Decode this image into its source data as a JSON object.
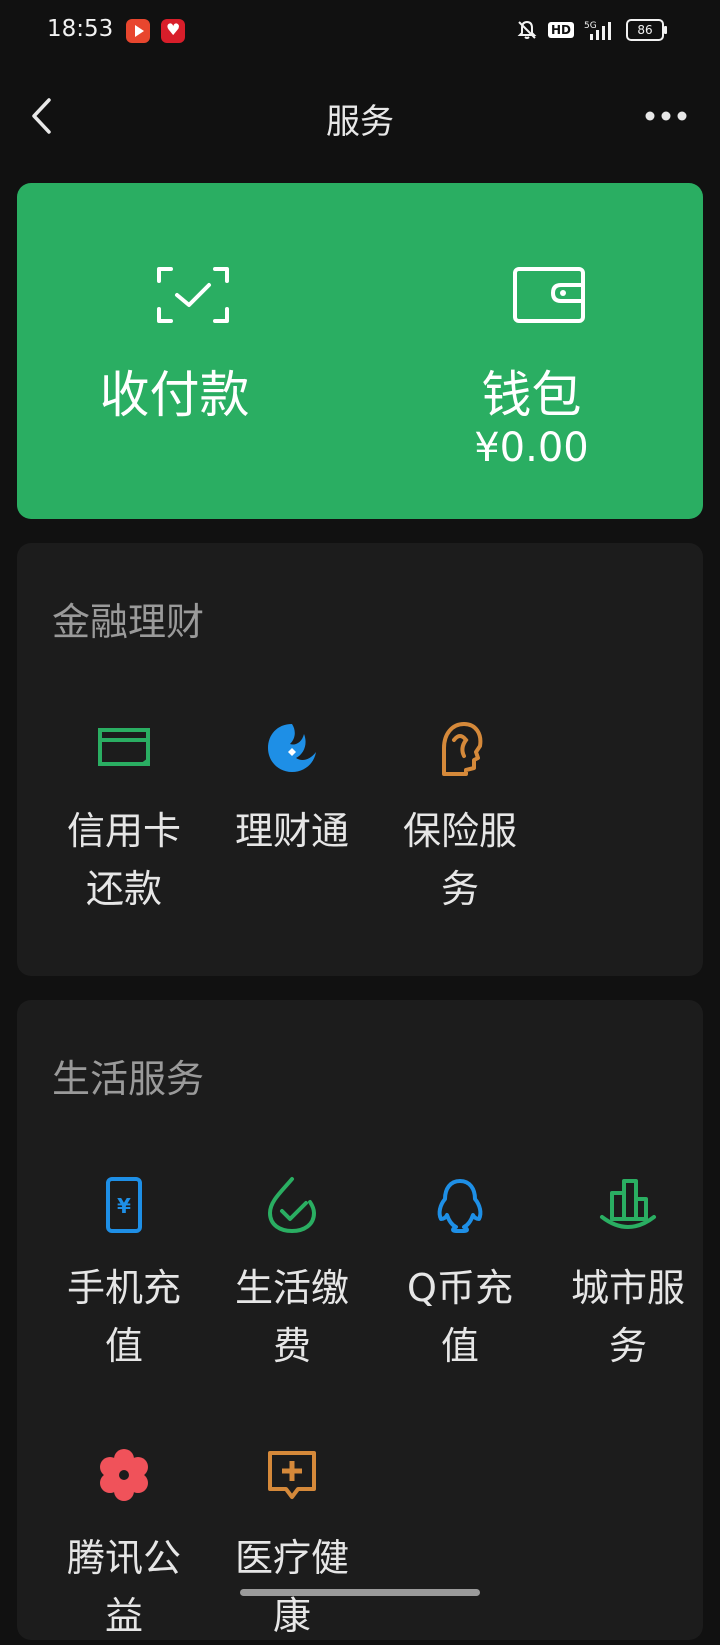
{
  "status_bar": {
    "time": "18:53",
    "hd": "HD",
    "network": "5G",
    "battery": "86"
  },
  "nav": {
    "title": "服务"
  },
  "green_card": {
    "pay_label": "收付款",
    "wallet_label": "钱包",
    "wallet_balance": "¥0.00",
    "color": "#2aae62"
  },
  "finance": {
    "title": "金融理财",
    "items": [
      {
        "label": "信用卡\n还款",
        "icon": "credit-card-icon",
        "color": "#2aae62"
      },
      {
        "label": "理财通",
        "icon": "licaitong-icon",
        "color": "#1e8fe6"
      },
      {
        "label": "保险服\n务",
        "icon": "insurance-icon",
        "color": "#d5893a"
      }
    ]
  },
  "life": {
    "title": "生活服务",
    "items": [
      {
        "label": "手机充\n值",
        "icon": "phone-recharge-icon",
        "color": "#1e8fe6"
      },
      {
        "label": "生活缴\n费",
        "icon": "utility-bill-icon",
        "color": "#2aae62"
      },
      {
        "label": "Q币充\n值",
        "icon": "qq-penguin-icon",
        "color": "#1e8fe6"
      },
      {
        "label": "城市服\n务",
        "icon": "city-building-icon",
        "color": "#2aae62"
      },
      {
        "label": "腾讯公\n益",
        "icon": "charity-flower-icon",
        "color": "#f0525a"
      },
      {
        "label": "医疗健\n康",
        "icon": "medical-cross-icon",
        "color": "#d5893a"
      }
    ]
  }
}
